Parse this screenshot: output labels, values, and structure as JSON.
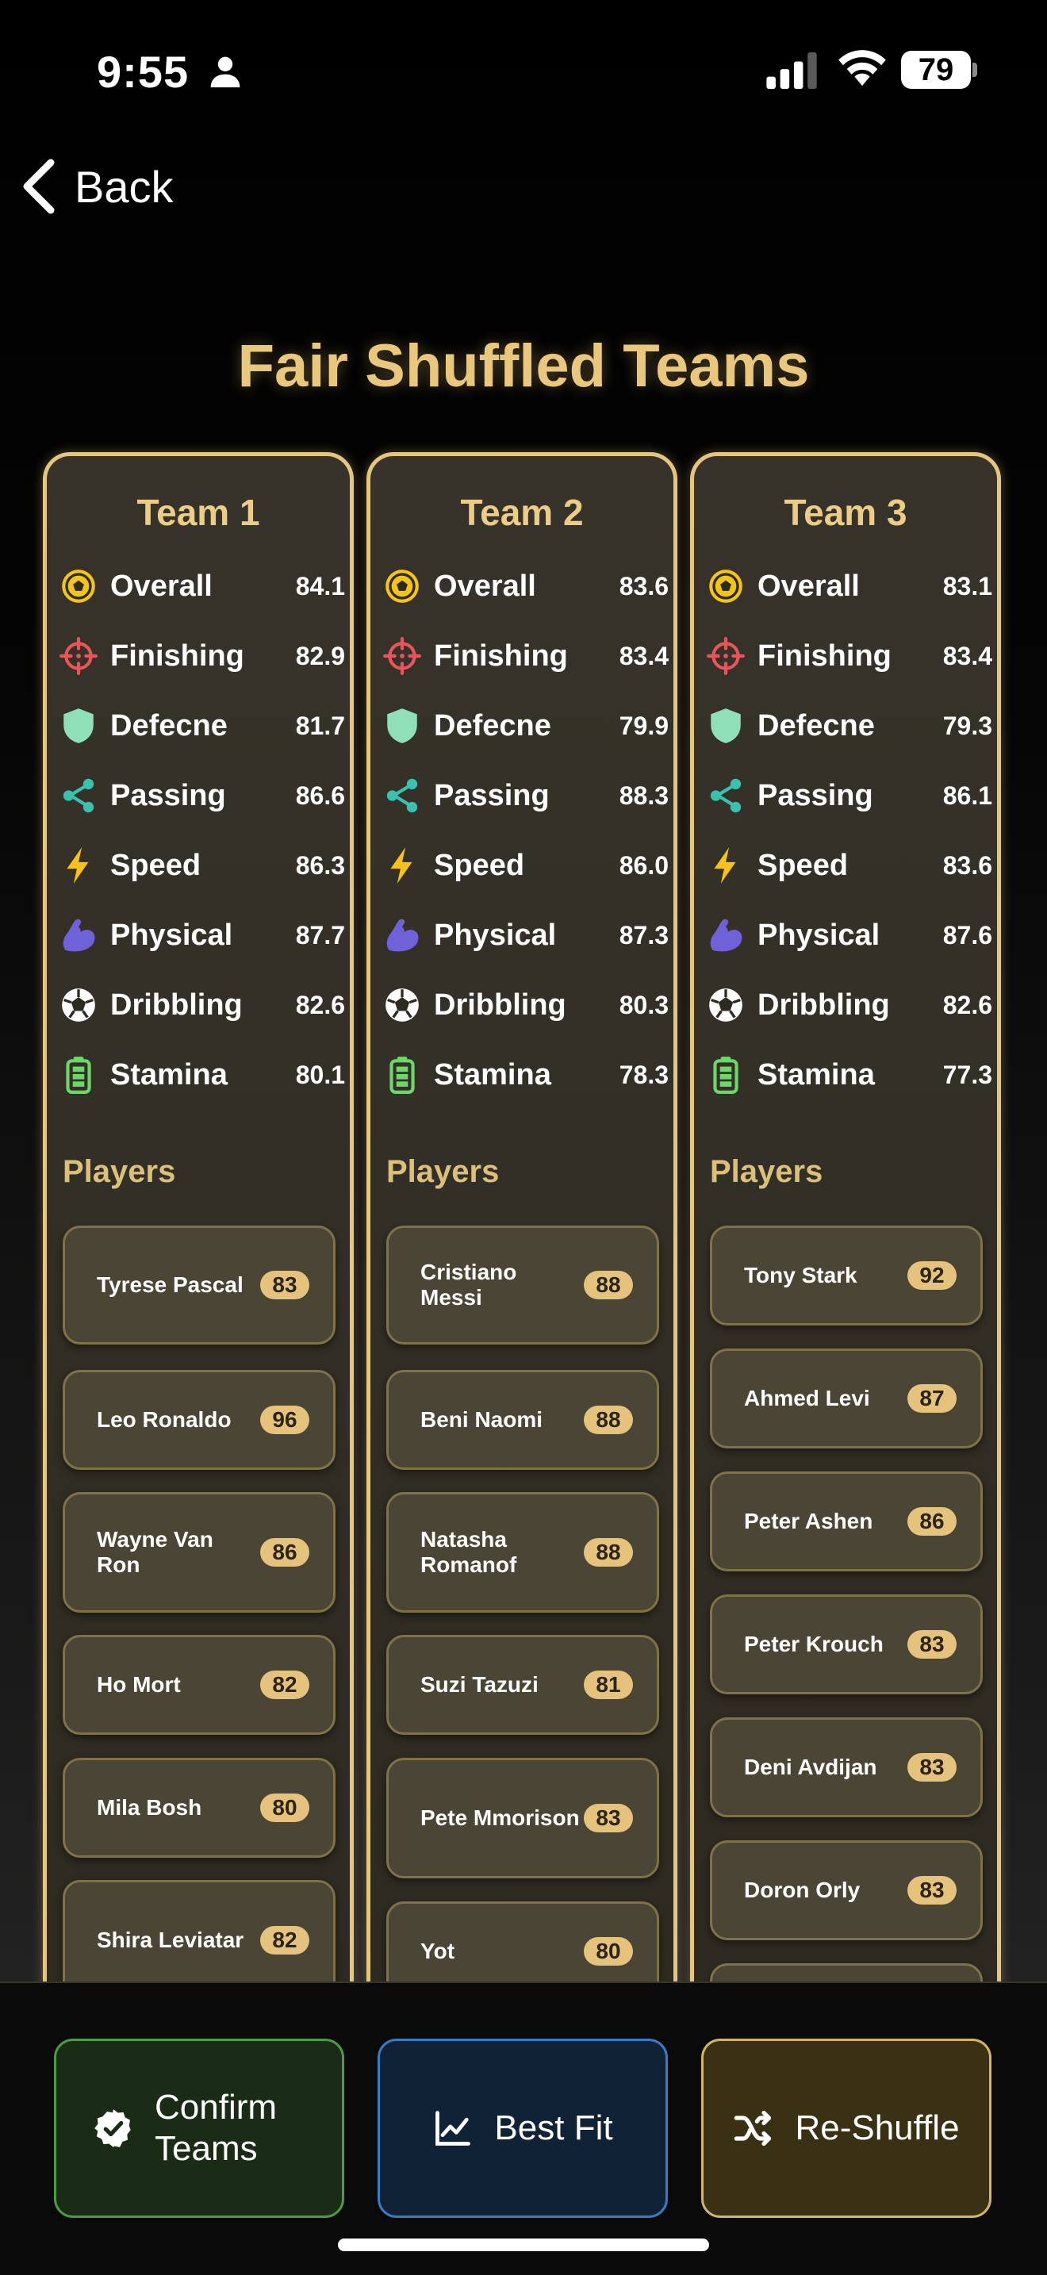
{
  "status_bar": {
    "time": "9:55",
    "battery": "79"
  },
  "nav": {
    "back_label": "Back"
  },
  "page": {
    "title": "Fair Shuffled Teams"
  },
  "stat_labels": [
    "Overall",
    "Finishing",
    "Defecne",
    "Passing",
    "Speed",
    "Physical",
    "Dribbling",
    "Stamina"
  ],
  "stat_icons": [
    "soccer-ball-icon",
    "crosshair-icon",
    "shield-icon",
    "share-icon",
    "lightning-icon",
    "flexed-arm-icon",
    "football-icon",
    "battery-icon"
  ],
  "teams": [
    {
      "name": "Team 1",
      "stats": [
        "84.1",
        "82.9",
        "81.7",
        "86.6",
        "86.3",
        "87.7",
        "82.6",
        "80.1"
      ],
      "players_heading": "Players",
      "players": [
        {
          "name": "Tyrese Pascal",
          "rating": "83"
        },
        {
          "name": "Leo Ronaldo",
          "rating": "96"
        },
        {
          "name": "Wayne Van Ron",
          "rating": "86"
        },
        {
          "name": "Ho Mort",
          "rating": "82"
        },
        {
          "name": "Mila Bosh",
          "rating": "80"
        },
        {
          "name": "Shira Leviatar",
          "rating": "82"
        }
      ]
    },
    {
      "name": "Team 2",
      "stats": [
        "83.6",
        "83.4",
        "79.9",
        "88.3",
        "86.0",
        "87.3",
        "80.3",
        "78.3"
      ],
      "players_heading": "Players",
      "players": [
        {
          "name": "Cristiano Messi",
          "rating": "88"
        },
        {
          "name": "Beni Naomi",
          "rating": "88"
        },
        {
          "name": "Natasha Romanof",
          "rating": "88"
        },
        {
          "name": "Suzi Tazuzi",
          "rating": "81"
        },
        {
          "name": "Pete Mmorison",
          "rating": "83"
        },
        {
          "name": "Yot",
          "rating": "80"
        }
      ]
    },
    {
      "name": "Team 3",
      "stats": [
        "83.1",
        "83.4",
        "79.3",
        "86.1",
        "83.6",
        "87.6",
        "82.6",
        "77.3"
      ],
      "players_heading": "Players",
      "players": [
        {
          "name": "Tony Stark",
          "rating": "92"
        },
        {
          "name": "Ahmed Levi",
          "rating": "87"
        },
        {
          "name": "Peter Ashen",
          "rating": "86"
        },
        {
          "name": "Peter Krouch",
          "rating": "83"
        },
        {
          "name": "Deni Avdijan",
          "rating": "83"
        },
        {
          "name": "Doron Orly",
          "rating": "83"
        }
      ]
    }
  ],
  "actions": {
    "confirm_label": "Confirm Teams",
    "bestfit_label": "Best Fit",
    "reshuffle_label": "Re-Shuffle"
  },
  "colors": {
    "accent_gold": "#e4c681",
    "confirm_green": "#4d9a46",
    "bestfit_blue": "#3b7bc4"
  }
}
